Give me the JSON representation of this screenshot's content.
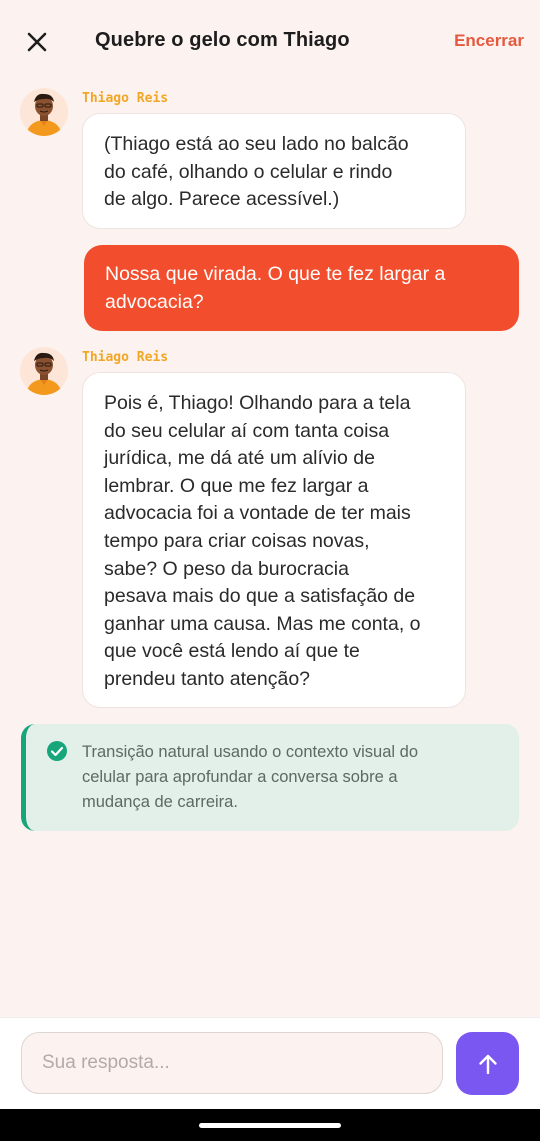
{
  "header": {
    "title": "Quebre o gelo com Thiago",
    "end_label": "Encerrar"
  },
  "messages": [
    {
      "role": "incoming",
      "sender": "Thiago Reis",
      "lines": [
        "(Thiago está ao seu lado no balcão",
        "do café, olhando o celular e rindo",
        "de algo. Parece acessível.)"
      ]
    },
    {
      "role": "outgoing",
      "lines": [
        "Nossa que virada. O que te fez largar a",
        "advocacia?"
      ]
    },
    {
      "role": "incoming",
      "sender": "Thiago Reis",
      "lines": [
        "Pois é, Thiago! Olhando para a tela",
        "do seu celular aí com tanta coisa",
        "jurídica, me dá até um alívio de",
        "lembrar. O que me fez largar a",
        "advocacia foi a vontade de ter mais",
        "tempo para criar coisas novas,",
        "sabe? O peso da burocracia",
        "pesava mais do que a satisfação de",
        "ganhar uma causa. Mas me conta, o",
        "que você está lendo aí que te",
        "prendeu tanto atenção?"
      ]
    }
  ],
  "feedback": {
    "lines": [
      "Transição natural usando o contexto visual do",
      "celular para aprofundar a conversa sobre a",
      "mudança de carreira."
    ]
  },
  "composer": {
    "placeholder": "Sua resposta...",
    "value": ""
  },
  "colors": {
    "background": "#fcf3f0",
    "accent_end": "#e55a3f",
    "outgoing_bubble": "#f24e2e",
    "sender_name": "#f2a623",
    "feedback_bg": "#e3efe9",
    "feedback_accent": "#17a57a",
    "send_button": "#7b57f2"
  },
  "icons": {
    "close": "close-icon",
    "feedback": "check-circle-icon",
    "send": "arrow-up-icon"
  }
}
